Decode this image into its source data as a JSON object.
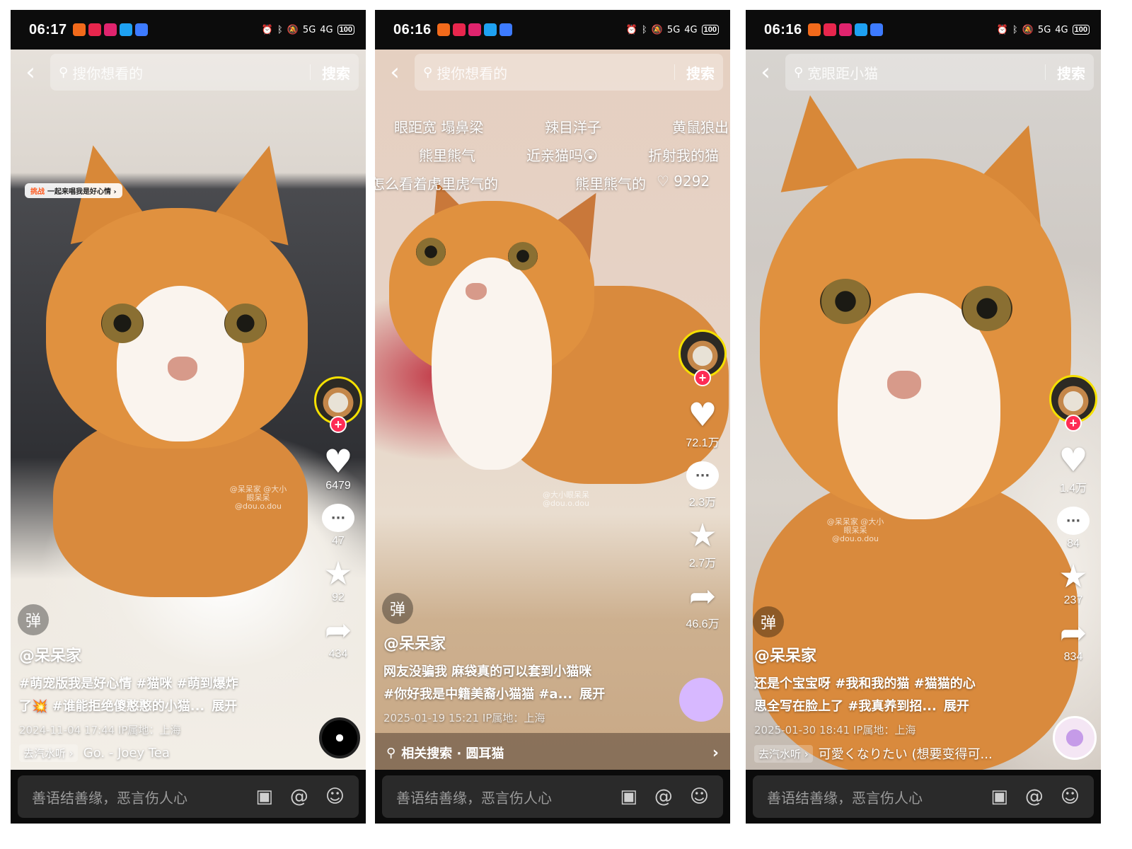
{
  "common": {
    "search_button": "搜索",
    "comment_placeholder": "善语结善缘，恶言伤人心",
    "danmu_label": "弹",
    "author": "@呆呆家",
    "expand": "展开",
    "listen_tag": "去汽水听 ›",
    "battery": "100",
    "net1": "5G",
    "net2": "4G"
  },
  "screen1": {
    "time": "06:17",
    "search_placeholder": "搜你想看的",
    "challenge_tag": "挑战",
    "challenge_text": "一起来唱我是好心情 ›",
    "likes": "6479",
    "comments": "47",
    "favorites": "92",
    "shares": "434",
    "desc_line1": "#萌宠版我是好心情 #猫咪 #萌到爆炸",
    "desc_line2": "了💥 #谁能拒绝傻憨憨的小猫...",
    "meta": "2024-11-04 17:44  IP属地：上海",
    "music": "Go. - Joey Tea",
    "disc_label": "Go.",
    "watermark": "@呆呆家 @大小眼呆呆 @dou.o.dou"
  },
  "screen2": {
    "time": "06:16",
    "search_placeholder": "搜你想看的",
    "barrage": [
      "眼距宽 塌鼻梁",
      "辣目洋子",
      "黄鼠狼出",
      "熊里熊气",
      "近亲猫吗😲",
      "折射我的猫",
      "怎么看着虎里虎气的",
      "熊里熊气的",
      "♡ 9292"
    ],
    "likes": "72.1万",
    "comments": "2.3万",
    "favorites": "2.7万",
    "shares": "46.6万",
    "desc_line1": "网友没骗我 麻袋真的可以套到小猫咪",
    "desc_line2": "#你好我是中籍美裔小猫猫 #a...",
    "meta": "2025-01-19 15:21  IP属地：上海",
    "related_label": "相关搜索 · 圆耳猫",
    "watermark": "@大小眼呆呆 @dou.o.dou"
  },
  "screen3": {
    "time": "06:16",
    "search_placeholder": "宽眼距小猫",
    "likes": "1.4万",
    "comments": "84",
    "favorites": "237",
    "shares": "834",
    "desc_line1": "还是个宝宝呀 #我和我的猫 #猫猫的心",
    "desc_line2": "思全写在脸上了 #我真养到招...",
    "meta": "2025-01-30 18:41  IP属地：上海",
    "music": "可愛くなりたい (想要变得可...",
    "watermark": "@呆呆家 @大小眼呆呆 @dou.o.dou"
  }
}
